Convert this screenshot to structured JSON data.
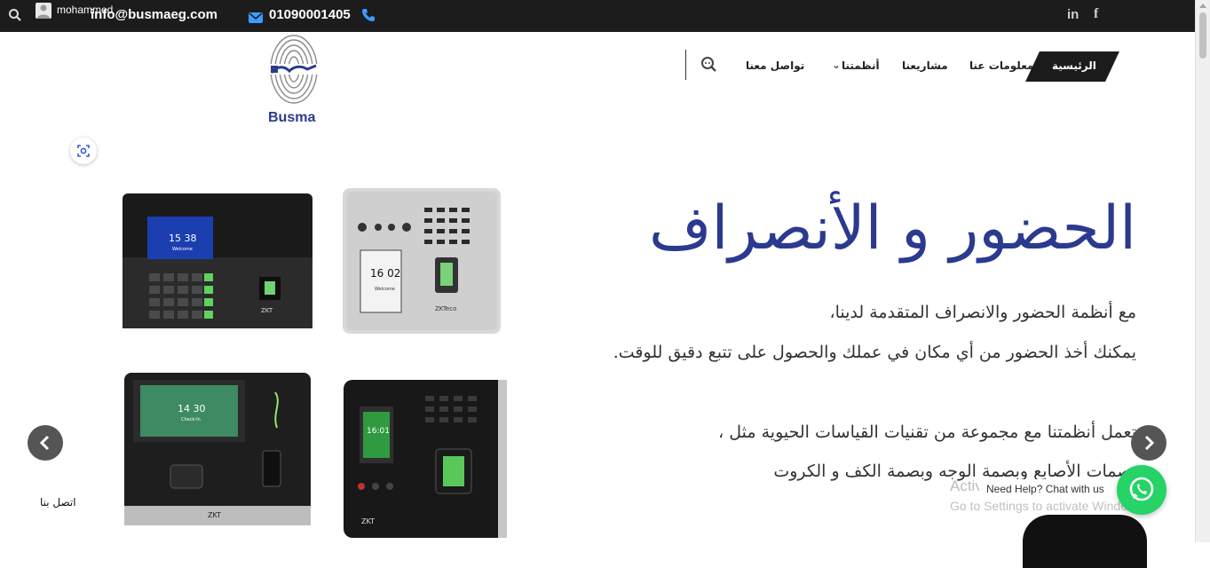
{
  "topbar": {
    "user_name": "mohammed ...",
    "email": "info@busmaeg.com",
    "phone": "01090001405",
    "social": {
      "linkedin": "in",
      "facebook": "f"
    }
  },
  "logo": {
    "text": "Busma"
  },
  "nav": {
    "items": [
      {
        "label": "الرئيسية"
      },
      {
        "label": "معلومات عنا"
      },
      {
        "label": "مشاريعنا"
      },
      {
        "label": "أنظمتنا"
      },
      {
        "label": "تواصل معنا"
      }
    ]
  },
  "hero": {
    "title": "الحضور و الأنصراف",
    "lines": [
      "مع أنظمة الحضور والانصراف المتقدمة لدينا،",
      "يمكنك أخذ الحضور من أي مكان في عملك والحصول على تتبع دقيق للوقت.",
      "تعمل أنظمتنا مع مجموعة من تقنيات القياسات الحيوية مثل ،",
      "بصمات الأصابع وبصمة الوجه وبصمة الكف و الكروت"
    ]
  },
  "devices": {
    "d1": {
      "time": "15 38",
      "sub": "Welcome",
      "brand": "ZKT"
    },
    "d2": {
      "time": "16 02",
      "sub": "Welcome",
      "brand": "ZKTeco"
    },
    "d3": {
      "time": "14 30",
      "sub": "Check-In",
      "brand": "ZKT"
    },
    "d4": {
      "time": "16:01",
      "brand": "ZKT"
    }
  },
  "contact_link": "اتصل بنا",
  "whatsapp": {
    "tooltip": "Need Help? Chat with us"
  },
  "watermark": {
    "line1": "Activate Windows",
    "line2": "Go to Settings to activate Windows."
  },
  "colors": {
    "brand_blue": "#2b3a8e",
    "topbar": "#1c1c1c",
    "whatsapp": "#25d366",
    "email_icon": "#3b9cff"
  }
}
